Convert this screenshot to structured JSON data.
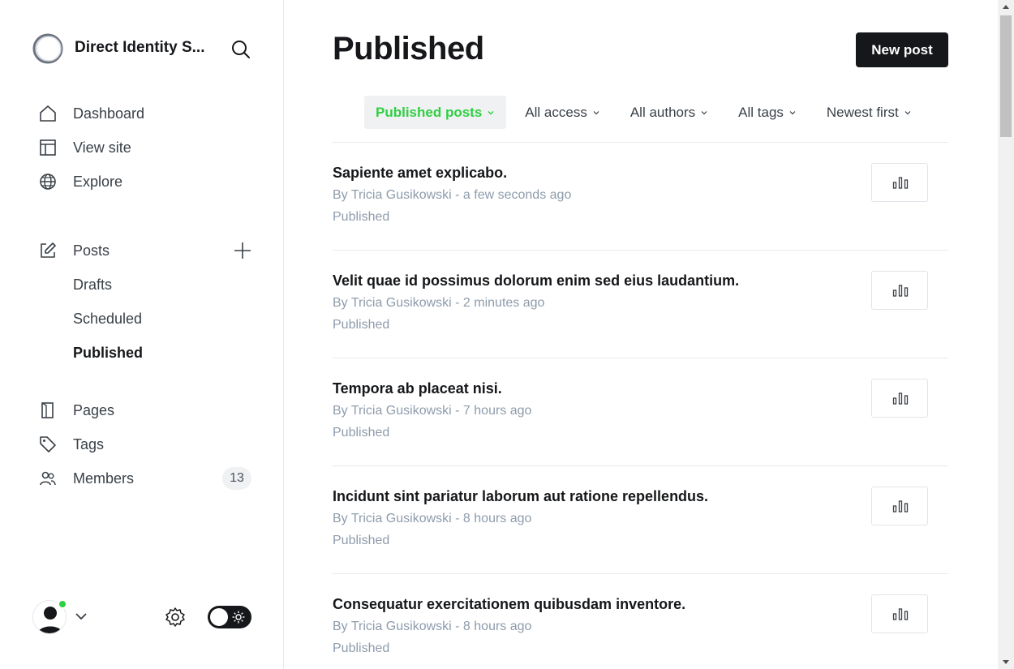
{
  "brand": {
    "name": "Direct Identity S...",
    "logo_icon": "circle-logo",
    "search_icon": "search-icon"
  },
  "nav": {
    "primary": [
      {
        "label": "Dashboard",
        "icon": "home-icon"
      },
      {
        "label": "View site",
        "icon": "layout-icon"
      },
      {
        "label": "Explore",
        "icon": "globe-icon"
      }
    ],
    "posts": {
      "label": "Posts",
      "icon": "edit-icon",
      "add_icon": "plus-icon"
    },
    "posts_sub": [
      {
        "label": "Drafts"
      },
      {
        "label": "Scheduled"
      },
      {
        "label": "Published",
        "active": true
      }
    ],
    "secondary": [
      {
        "label": "Pages",
        "icon": "page-icon"
      },
      {
        "label": "Tags",
        "icon": "tag-icon"
      },
      {
        "label": "Members",
        "icon": "members-icon",
        "badge": "13"
      }
    ]
  },
  "footer": {
    "avatar_icon": "user-avatar",
    "status_color": "#30cf43",
    "settings_icon": "gear-icon",
    "theme_toggle_icon": "sun-icon"
  },
  "header": {
    "title": "Published",
    "new_post_label": "New post"
  },
  "filters": [
    {
      "label": "Published posts",
      "selected": true
    },
    {
      "label": "All access"
    },
    {
      "label": "All authors"
    },
    {
      "label": "All tags"
    },
    {
      "label": "Newest first"
    }
  ],
  "posts": [
    {
      "title": "Sapiente amet explicabo.",
      "author": "By Tricia Gusikowski",
      "time": "a few seconds ago",
      "status": "Published"
    },
    {
      "title": "Velit quae id possimus dolorum enim sed eius laudantium.",
      "author": "By Tricia Gusikowski",
      "time": "2 minutes ago",
      "status": "Published"
    },
    {
      "title": "Tempora ab placeat nisi.",
      "author": "By Tricia Gusikowski",
      "time": "7 hours ago",
      "status": "Published"
    },
    {
      "title": "Incidunt sint pariatur laborum aut ratione repellendus.",
      "author": "By Tricia Gusikowski",
      "time": "8 hours ago",
      "status": "Published"
    },
    {
      "title": "Consequatur exercitationem quibusdam inventore.",
      "author": "By Tricia Gusikowski",
      "time": "8 hours ago",
      "status": "Published"
    }
  ],
  "colors": {
    "accent": "#30cf43",
    "dark": "#15171a",
    "muted": "#8e9cac"
  }
}
